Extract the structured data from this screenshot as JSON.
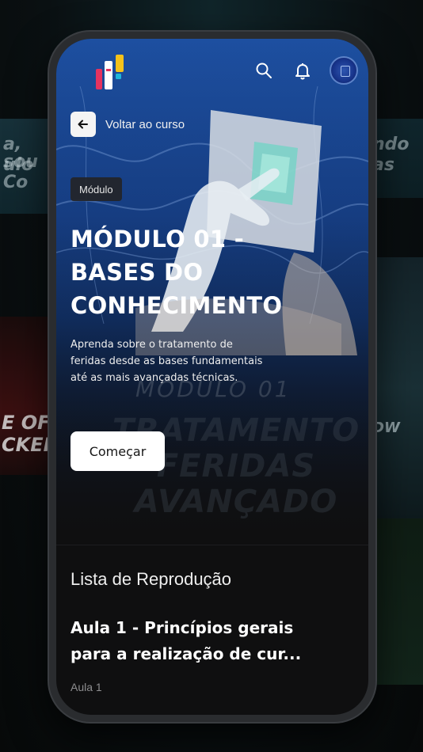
{
  "background_cards": {
    "left_top_lines": [
      "a, sou",
      "ulo Co"
    ],
    "left_bottom_text": "E OF\nCKER",
    "right_top_lines": [
      "ndo",
      "as"
    ],
    "right_bottom_text": "DW"
  },
  "header": {
    "logo": "brand-logo",
    "search_icon": "search-icon",
    "bell_icon": "bell-icon",
    "avatar": "user-avatar"
  },
  "hero": {
    "back_label": "Voltar ao curso",
    "tag": "Módulo",
    "title": "MÓDULO 01 - BASES DO CONHECIMENTO",
    "description": "Aprenda sobre o tratamento de feridas desde as bases fundamentais até as mais avançadas técnicas.",
    "cta_label": "Começar",
    "art_caption": "MÓDULO 01",
    "art_lines": [
      "TRATAMENTO",
      "FERIDAS",
      "AVANÇADO"
    ]
  },
  "playlist": {
    "title": "Lista de Reprodução",
    "items": [
      {
        "title": "Aula 1 - Princípios gerais para a realização de cur...",
        "subtitle": "Aula 1"
      }
    ]
  },
  "colors": {
    "hero_blue": "#1d4fa0",
    "screen_bg": "#0f0f10",
    "cta_bg": "#ffffff",
    "logo_pink": "#e5335f",
    "logo_yellow": "#f4c21b",
    "logo_cyan": "#1fb6d9"
  }
}
